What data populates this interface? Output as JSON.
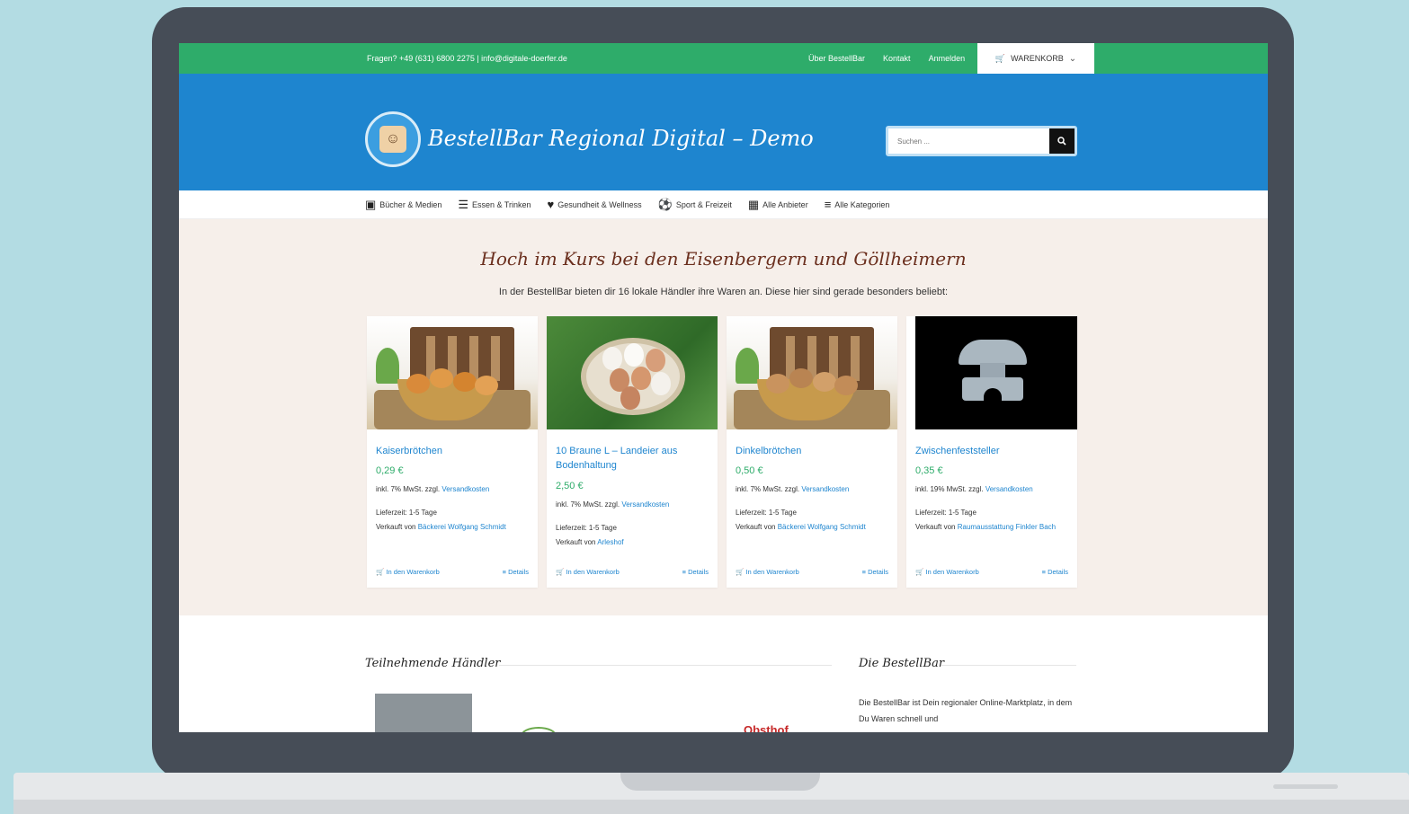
{
  "topbar": {
    "contact": "Fragen? +49 (631) 6800 2275 | info@digitale-doerfer.de",
    "links": [
      "Über BestellBar",
      "Kontakt",
      "Anmelden"
    ],
    "cart_label": "WARENKORB"
  },
  "header": {
    "site_title": "BestellBar Regional Digital – Demo",
    "search_placeholder": "Suchen ..."
  },
  "nav": [
    {
      "label": "Bücher & Medien",
      "icon": "film-icon"
    },
    {
      "label": "Essen & Trinken",
      "icon": "cutlery-icon"
    },
    {
      "label": "Gesundheit & Wellness",
      "icon": "heart-icon"
    },
    {
      "label": "Sport & Freizeit",
      "icon": "soccer-ball-icon"
    },
    {
      "label": "Alle Anbieter",
      "icon": "building-icon"
    },
    {
      "label": "Alle Kategorien",
      "icon": "list-icon"
    }
  ],
  "featured": {
    "title": "Hoch im Kurs bei den Eisenbergern und Göllheimern",
    "subtitle": "In der BestellBar bieten dir 16 lokale Händler ihre Waren an. Diese hier sind gerade besonders beliebt:"
  },
  "products": [
    {
      "name": "Kaiserbrötchen",
      "price": "0,29 €",
      "tax_prefix": "inkl. 7% MwSt. zzgl.",
      "tax_link": "Versandkosten",
      "delivery": "Lieferzeit: 1-5 Tage",
      "seller_prefix": "Verkauft von",
      "seller": "Bäckerei Wolfgang Schmidt",
      "cart_action": "In den Warenkorb",
      "details_action": "Details"
    },
    {
      "name": "10 Braune L – Landeier aus Bodenhaltung",
      "price": "2,50 €",
      "tax_prefix": "inkl. 7% MwSt. zzgl.",
      "tax_link": "Versandkosten",
      "delivery": "Lieferzeit: 1-5 Tage",
      "seller_prefix": "Verkauft von",
      "seller": "Arleshof",
      "cart_action": "In den Warenkorb",
      "details_action": "Details"
    },
    {
      "name": "Dinkelbrötchen",
      "price": "0,50 €",
      "tax_prefix": "inkl. 7% MwSt. zzgl.",
      "tax_link": "Versandkosten",
      "delivery": "Lieferzeit: 1-5 Tage",
      "seller_prefix": "Verkauft von",
      "seller": "Bäckerei Wolfgang Schmidt",
      "cart_action": "In den Warenkorb",
      "details_action": "Details"
    },
    {
      "name": "Zwischenfeststeller",
      "price": "0,35 €",
      "tax_prefix": "inkl. 19% MwSt. zzgl.",
      "tax_link": "Versandkosten",
      "delivery": "Lieferzeit: 1-5 Tage",
      "seller_prefix": "Verkauft von",
      "seller": "Raumausstattung Finkler Bach",
      "cart_action": "In den Warenkorb",
      "details_action": "Details"
    }
  ],
  "bottom": {
    "merchants_title": "Teilnehmende Händler",
    "about_title": "Die BestellBar",
    "about_text": "Die BestellBar ist Dein regionaler Online-Marktplatz, in dem Du Waren schnell und",
    "merchant_logo_text": "Obsthof"
  },
  "colors": {
    "topbar": "#2eac6a",
    "header": "#1e85cf",
    "featured_bg": "#f6efea",
    "link": "#1e85cf",
    "price": "#2eac6a"
  }
}
